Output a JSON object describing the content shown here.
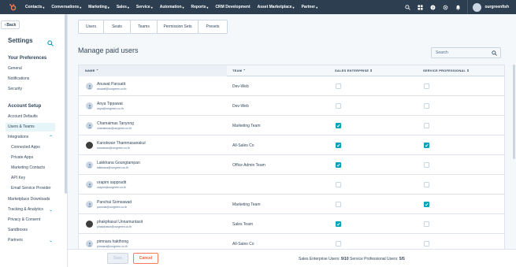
{
  "topnav": {
    "items": [
      {
        "label": "Contacts"
      },
      {
        "label": "Conversations"
      },
      {
        "label": "Marketing"
      },
      {
        "label": "Sales"
      },
      {
        "label": "Service"
      },
      {
        "label": "Automation"
      },
      {
        "label": "Reports"
      },
      {
        "label": "CRM Development"
      },
      {
        "label": "Asset Marketplace"
      },
      {
        "label": "Partner"
      }
    ],
    "account_name": "ourgreenfish",
    "colors": {
      "bar": "#2d3e50",
      "logo": "#ff7a59"
    }
  },
  "sidebar": {
    "back_label": "Back",
    "title": "Settings",
    "sections": {
      "preferences": "Your Preferences",
      "account_setup": "Account Setup"
    },
    "preferences_items": [
      "General",
      "Notifications",
      "Security"
    ],
    "account_items": {
      "defaults": "Account Defaults",
      "users_teams": "Users & Teams",
      "integrations": "Integrations",
      "connected_apps": "Connected Apps",
      "private_apps": "Private Apps",
      "marketing_contacts": "Marketing Contacts",
      "api_key": "API Key",
      "email_service_provider": "Email Service Provider",
      "marketplace_downloads": "Marketplace Downloads",
      "tracking_analytics": "Tracking & Analytics",
      "privacy_consent": "Privacy & Consent",
      "sandboxes": "Sandboxes",
      "partners": "Partners"
    }
  },
  "tabs": [
    "Users",
    "Seats",
    "Teams",
    "Permission Sets",
    "Presets"
  ],
  "page": {
    "title": "Manage paid users",
    "search_placeholder": "Search"
  },
  "table": {
    "headers": {
      "name": "NAME",
      "team": "TEAM",
      "sales": "SALES ENTERPRISE",
      "service": "SERVICE PROFESSIONAL"
    },
    "rows": [
      {
        "name": "Anuwat Pansatit",
        "email": "anuwat@ourgreen.co.th",
        "team": "Dev-Web",
        "sales": false,
        "service": false,
        "avatar": "default"
      },
      {
        "name": "Anya Tippawat",
        "email": "anya@ourgreen.co.th",
        "team": "Dev-Web",
        "sales": false,
        "service": false,
        "avatar": "default"
      },
      {
        "name": "Chamaimas Tanyong",
        "email": "chamaimas@ourgreen.co.th",
        "team": "Marketing Team",
        "sales": true,
        "service": false,
        "avatar": "default"
      },
      {
        "name": "Kanokwan Thammasanakul",
        "email": "kanokwan@ourgreen.co.th",
        "team": "All-Sales Co",
        "sales": true,
        "service": true,
        "avatar": "photo"
      },
      {
        "name": "Lakkhana Goungtampan",
        "email": "lakkhana@ourgreen.co.th",
        "team": "Office Admin Team",
        "sales": true,
        "service": false,
        "avatar": "default"
      },
      {
        "name": "orapim sappradit",
        "email": "orapim@ourgreen.co.th",
        "team": "",
        "sales": false,
        "service": false,
        "avatar": "default"
      },
      {
        "name": "Panchai Somsawad",
        "email": "panchai@ourgreen.co.th",
        "team": "Marketing Team",
        "sales": false,
        "service": true,
        "avatar": "default"
      },
      {
        "name": "phakphasut Unnamuntasit",
        "email": "phakphasut@ourgreen.co.th",
        "team": "Sales Team",
        "sales": true,
        "service": false,
        "avatar": "photo"
      },
      {
        "name": "pimnara hakthong",
        "email": "pimnara@ourgreen.co.th",
        "team": "All-Sales Co",
        "sales": false,
        "service": false,
        "avatar": "default"
      },
      {
        "name": "",
        "email": "",
        "team": "",
        "sales": false,
        "service": false,
        "avatar": "default"
      }
    ]
  },
  "footer": {
    "save_label": "Save",
    "cancel_label": "Cancel",
    "sales_label": "Sales Enterprise Users:",
    "sales_value": "9/10",
    "service_label": "Service Professional Users:",
    "service_value": "5/5"
  },
  "colors": {
    "accent": "#00a4bd",
    "cancel": "#ff7a59"
  }
}
